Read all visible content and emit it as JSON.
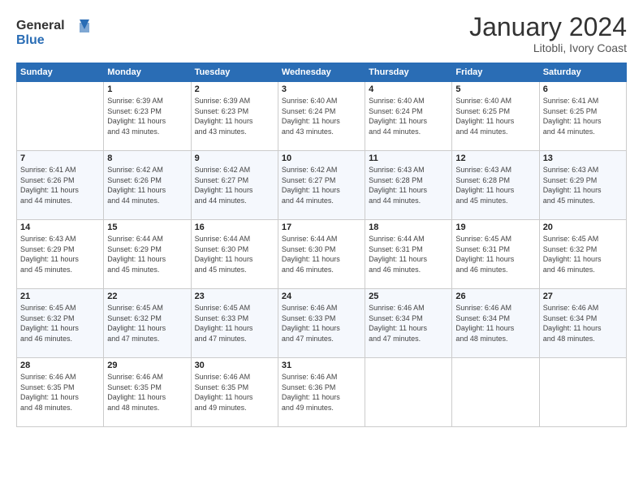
{
  "header": {
    "logo_line1": "General",
    "logo_line2": "Blue",
    "month": "January 2024",
    "location": "Litobli, Ivory Coast"
  },
  "weekdays": [
    "Sunday",
    "Monday",
    "Tuesday",
    "Wednesday",
    "Thursday",
    "Friday",
    "Saturday"
  ],
  "weeks": [
    [
      {
        "day": "",
        "info": ""
      },
      {
        "day": "1",
        "info": "Sunrise: 6:39 AM\nSunset: 6:23 PM\nDaylight: 11 hours\nand 43 minutes."
      },
      {
        "day": "2",
        "info": "Sunrise: 6:39 AM\nSunset: 6:23 PM\nDaylight: 11 hours\nand 43 minutes."
      },
      {
        "day": "3",
        "info": "Sunrise: 6:40 AM\nSunset: 6:24 PM\nDaylight: 11 hours\nand 43 minutes."
      },
      {
        "day": "4",
        "info": "Sunrise: 6:40 AM\nSunset: 6:24 PM\nDaylight: 11 hours\nand 44 minutes."
      },
      {
        "day": "5",
        "info": "Sunrise: 6:40 AM\nSunset: 6:25 PM\nDaylight: 11 hours\nand 44 minutes."
      },
      {
        "day": "6",
        "info": "Sunrise: 6:41 AM\nSunset: 6:25 PM\nDaylight: 11 hours\nand 44 minutes."
      }
    ],
    [
      {
        "day": "7",
        "info": "Sunrise: 6:41 AM\nSunset: 6:26 PM\nDaylight: 11 hours\nand 44 minutes."
      },
      {
        "day": "8",
        "info": "Sunrise: 6:42 AM\nSunset: 6:26 PM\nDaylight: 11 hours\nand 44 minutes."
      },
      {
        "day": "9",
        "info": "Sunrise: 6:42 AM\nSunset: 6:27 PM\nDaylight: 11 hours\nand 44 minutes."
      },
      {
        "day": "10",
        "info": "Sunrise: 6:42 AM\nSunset: 6:27 PM\nDaylight: 11 hours\nand 44 minutes."
      },
      {
        "day": "11",
        "info": "Sunrise: 6:43 AM\nSunset: 6:28 PM\nDaylight: 11 hours\nand 44 minutes."
      },
      {
        "day": "12",
        "info": "Sunrise: 6:43 AM\nSunset: 6:28 PM\nDaylight: 11 hours\nand 45 minutes."
      },
      {
        "day": "13",
        "info": "Sunrise: 6:43 AM\nSunset: 6:29 PM\nDaylight: 11 hours\nand 45 minutes."
      }
    ],
    [
      {
        "day": "14",
        "info": "Sunrise: 6:43 AM\nSunset: 6:29 PM\nDaylight: 11 hours\nand 45 minutes."
      },
      {
        "day": "15",
        "info": "Sunrise: 6:44 AM\nSunset: 6:29 PM\nDaylight: 11 hours\nand 45 minutes."
      },
      {
        "day": "16",
        "info": "Sunrise: 6:44 AM\nSunset: 6:30 PM\nDaylight: 11 hours\nand 45 minutes."
      },
      {
        "day": "17",
        "info": "Sunrise: 6:44 AM\nSunset: 6:30 PM\nDaylight: 11 hours\nand 46 minutes."
      },
      {
        "day": "18",
        "info": "Sunrise: 6:44 AM\nSunset: 6:31 PM\nDaylight: 11 hours\nand 46 minutes."
      },
      {
        "day": "19",
        "info": "Sunrise: 6:45 AM\nSunset: 6:31 PM\nDaylight: 11 hours\nand 46 minutes."
      },
      {
        "day": "20",
        "info": "Sunrise: 6:45 AM\nSunset: 6:32 PM\nDaylight: 11 hours\nand 46 minutes."
      }
    ],
    [
      {
        "day": "21",
        "info": "Sunrise: 6:45 AM\nSunset: 6:32 PM\nDaylight: 11 hours\nand 46 minutes."
      },
      {
        "day": "22",
        "info": "Sunrise: 6:45 AM\nSunset: 6:32 PM\nDaylight: 11 hours\nand 47 minutes."
      },
      {
        "day": "23",
        "info": "Sunrise: 6:45 AM\nSunset: 6:33 PM\nDaylight: 11 hours\nand 47 minutes."
      },
      {
        "day": "24",
        "info": "Sunrise: 6:46 AM\nSunset: 6:33 PM\nDaylight: 11 hours\nand 47 minutes."
      },
      {
        "day": "25",
        "info": "Sunrise: 6:46 AM\nSunset: 6:34 PM\nDaylight: 11 hours\nand 47 minutes."
      },
      {
        "day": "26",
        "info": "Sunrise: 6:46 AM\nSunset: 6:34 PM\nDaylight: 11 hours\nand 48 minutes."
      },
      {
        "day": "27",
        "info": "Sunrise: 6:46 AM\nSunset: 6:34 PM\nDaylight: 11 hours\nand 48 minutes."
      }
    ],
    [
      {
        "day": "28",
        "info": "Sunrise: 6:46 AM\nSunset: 6:35 PM\nDaylight: 11 hours\nand 48 minutes."
      },
      {
        "day": "29",
        "info": "Sunrise: 6:46 AM\nSunset: 6:35 PM\nDaylight: 11 hours\nand 48 minutes."
      },
      {
        "day": "30",
        "info": "Sunrise: 6:46 AM\nSunset: 6:35 PM\nDaylight: 11 hours\nand 49 minutes."
      },
      {
        "day": "31",
        "info": "Sunrise: 6:46 AM\nSunset: 6:36 PM\nDaylight: 11 hours\nand 49 minutes."
      },
      {
        "day": "",
        "info": ""
      },
      {
        "day": "",
        "info": ""
      },
      {
        "day": "",
        "info": ""
      }
    ]
  ]
}
